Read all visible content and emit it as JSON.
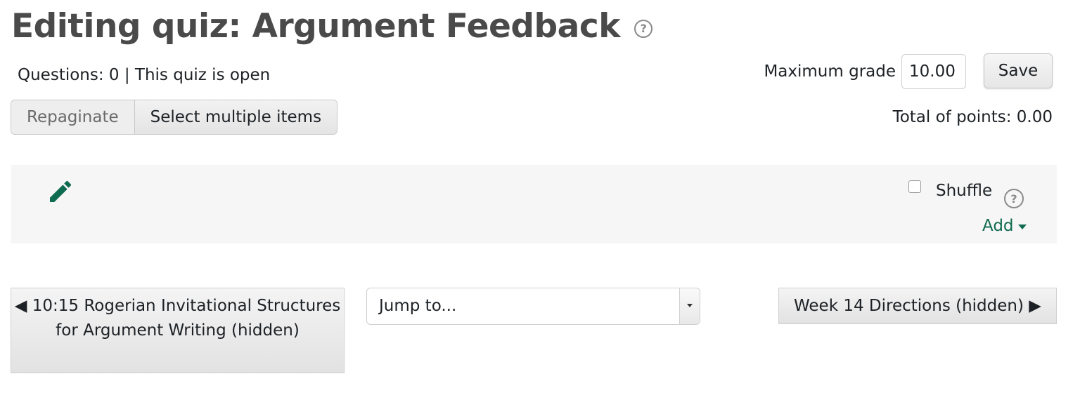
{
  "header": {
    "title": "Editing quiz: Argument Feedback",
    "help_glyph": "?",
    "status": "Questions: 0 | This quiz is open"
  },
  "toolbar": {
    "repaginate_label": "Repaginate",
    "select_multiple_label": "Select multiple items"
  },
  "grade": {
    "label": "Maximum grade",
    "value": "10.00",
    "save_label": "Save",
    "total_label": "Total of points: 0.00"
  },
  "section": {
    "edit_icon": "pencil-icon",
    "shuffle_label": "Shuffle",
    "shuffle_checked": false,
    "help_glyph": "?",
    "add_label": "Add"
  },
  "navigation": {
    "prev_label": "◀ 10:15 Rogerian Invitational Structures for Argument Writing (hidden)",
    "jump_value": "Jump to...",
    "next_label": "Week 14 Directions (hidden) ▶"
  },
  "colors": {
    "accent_green": "#0f6b4f",
    "section_bg": "#f6f6f6",
    "title_gray": "#4a4a4a"
  }
}
